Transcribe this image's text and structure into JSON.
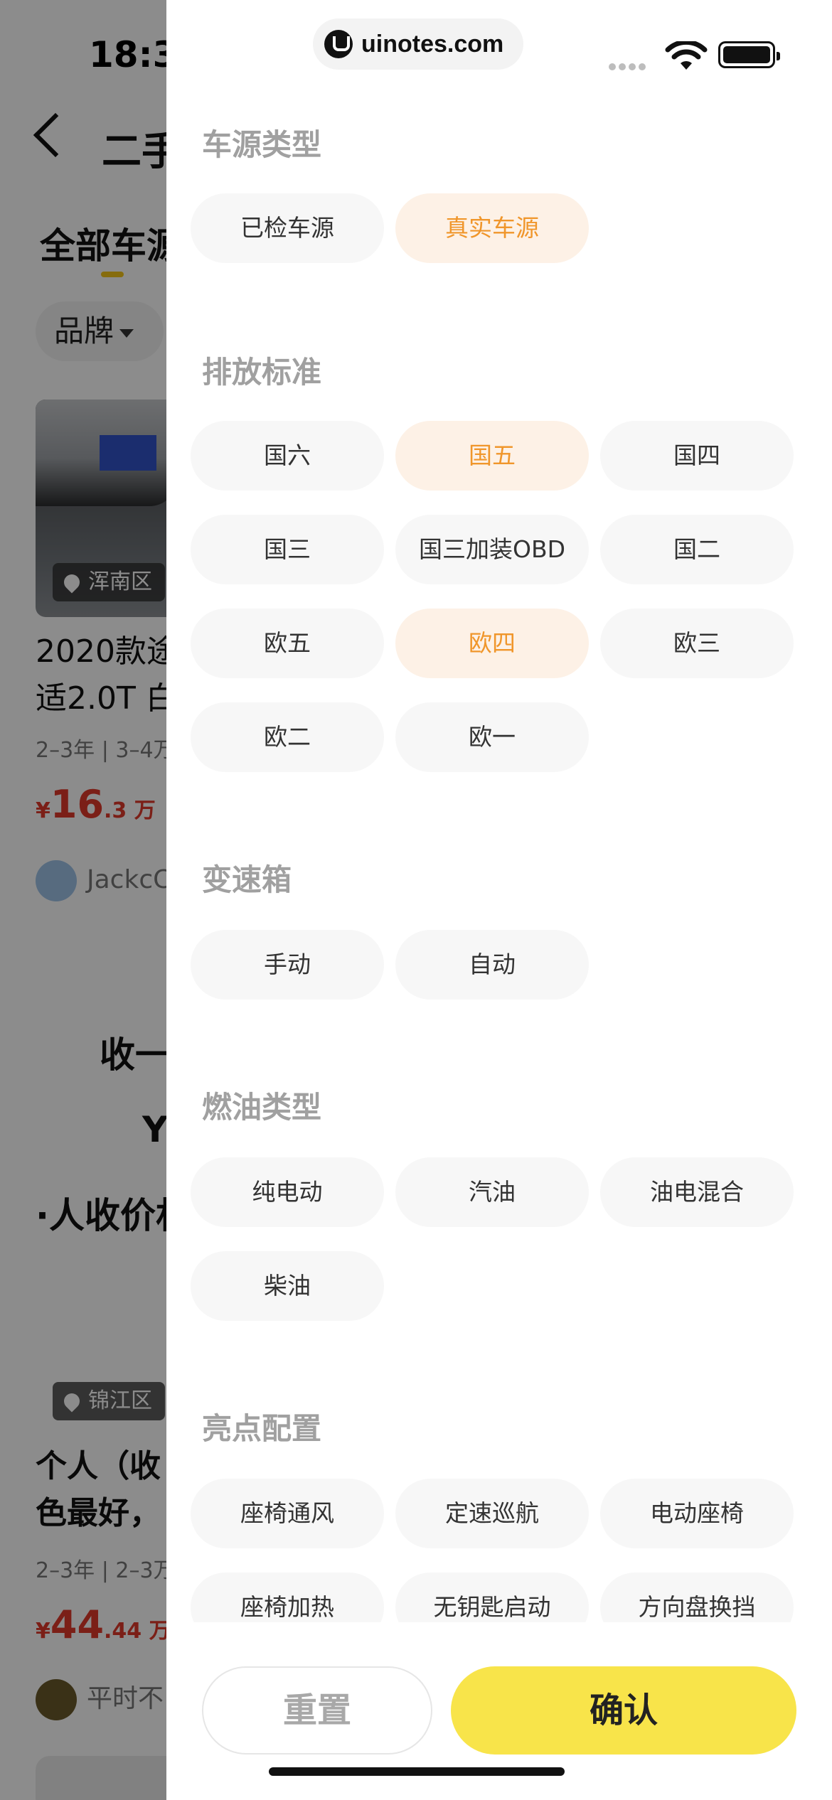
{
  "status_bar": {
    "time": "18:32"
  },
  "url_bar": {
    "domain": "uinotes.com"
  },
  "background_page": {
    "title": "二手",
    "tab_active": "全部车源",
    "filter_brand": "品牌",
    "listing_1": {
      "location": "浑南区",
      "title_line1": "2020款途",
      "title_line2": "适2.0T 白",
      "meta": "2–3年 | 3–4万",
      "price_currency": "¥",
      "price_main": "16",
      "price_decimal": ".3 万",
      "user": "JackcC"
    },
    "promo_line1": "收一",
    "promo_line2": "Y",
    "promo_line3": "·人收价村",
    "listing_2": {
      "location": "锦江区",
      "title_line1": "个人（收",
      "title_line2": "色最好，",
      "meta": "2–3年 | 2–3万",
      "price_currency": "¥",
      "price_main": "44",
      "price_decimal": ".44 万",
      "user": "平时不"
    }
  },
  "filters": {
    "source_type": {
      "title": "车源类型",
      "options": [
        {
          "label": "已检车源",
          "selected": false
        },
        {
          "label": "真实车源",
          "selected": true
        }
      ]
    },
    "emission": {
      "title": "排放标准",
      "options": [
        {
          "label": "国六",
          "selected": false
        },
        {
          "label": "国五",
          "selected": true
        },
        {
          "label": "国四",
          "selected": false
        },
        {
          "label": "国三",
          "selected": false
        },
        {
          "label": "国三加装OBD",
          "selected": false
        },
        {
          "label": "国二",
          "selected": false
        },
        {
          "label": "欧五",
          "selected": false
        },
        {
          "label": "欧四",
          "selected": true
        },
        {
          "label": "欧三",
          "selected": false
        },
        {
          "label": "欧二",
          "selected": false
        },
        {
          "label": "欧一",
          "selected": false
        }
      ]
    },
    "gearbox": {
      "title": "变速箱",
      "options": [
        {
          "label": "手动",
          "selected": false
        },
        {
          "label": "自动",
          "selected": false
        }
      ]
    },
    "fuel": {
      "title": "燃油类型",
      "options": [
        {
          "label": "纯电动",
          "selected": false
        },
        {
          "label": "汽油",
          "selected": false
        },
        {
          "label": "油电混合",
          "selected": false
        },
        {
          "label": "柴油",
          "selected": false
        }
      ]
    },
    "highlights": {
      "title": "亮点配置",
      "options": [
        {
          "label": "座椅通风",
          "selected": false
        },
        {
          "label": "定速巡航",
          "selected": false
        },
        {
          "label": "电动座椅",
          "selected": false
        },
        {
          "label": "座椅加热",
          "selected": false
        },
        {
          "label": "无钥匙启动",
          "selected": false
        },
        {
          "label": "方向盘换挡",
          "selected": false
        }
      ]
    }
  },
  "actions": {
    "reset_label": "重置",
    "confirm_label": "确认"
  },
  "colors": {
    "accent_yellow": "#f8e44a",
    "selected_text": "#f0962b",
    "selected_bg": "#fdf1e6",
    "chip_bg": "#f7f7f7",
    "price_red": "#e0392b"
  }
}
